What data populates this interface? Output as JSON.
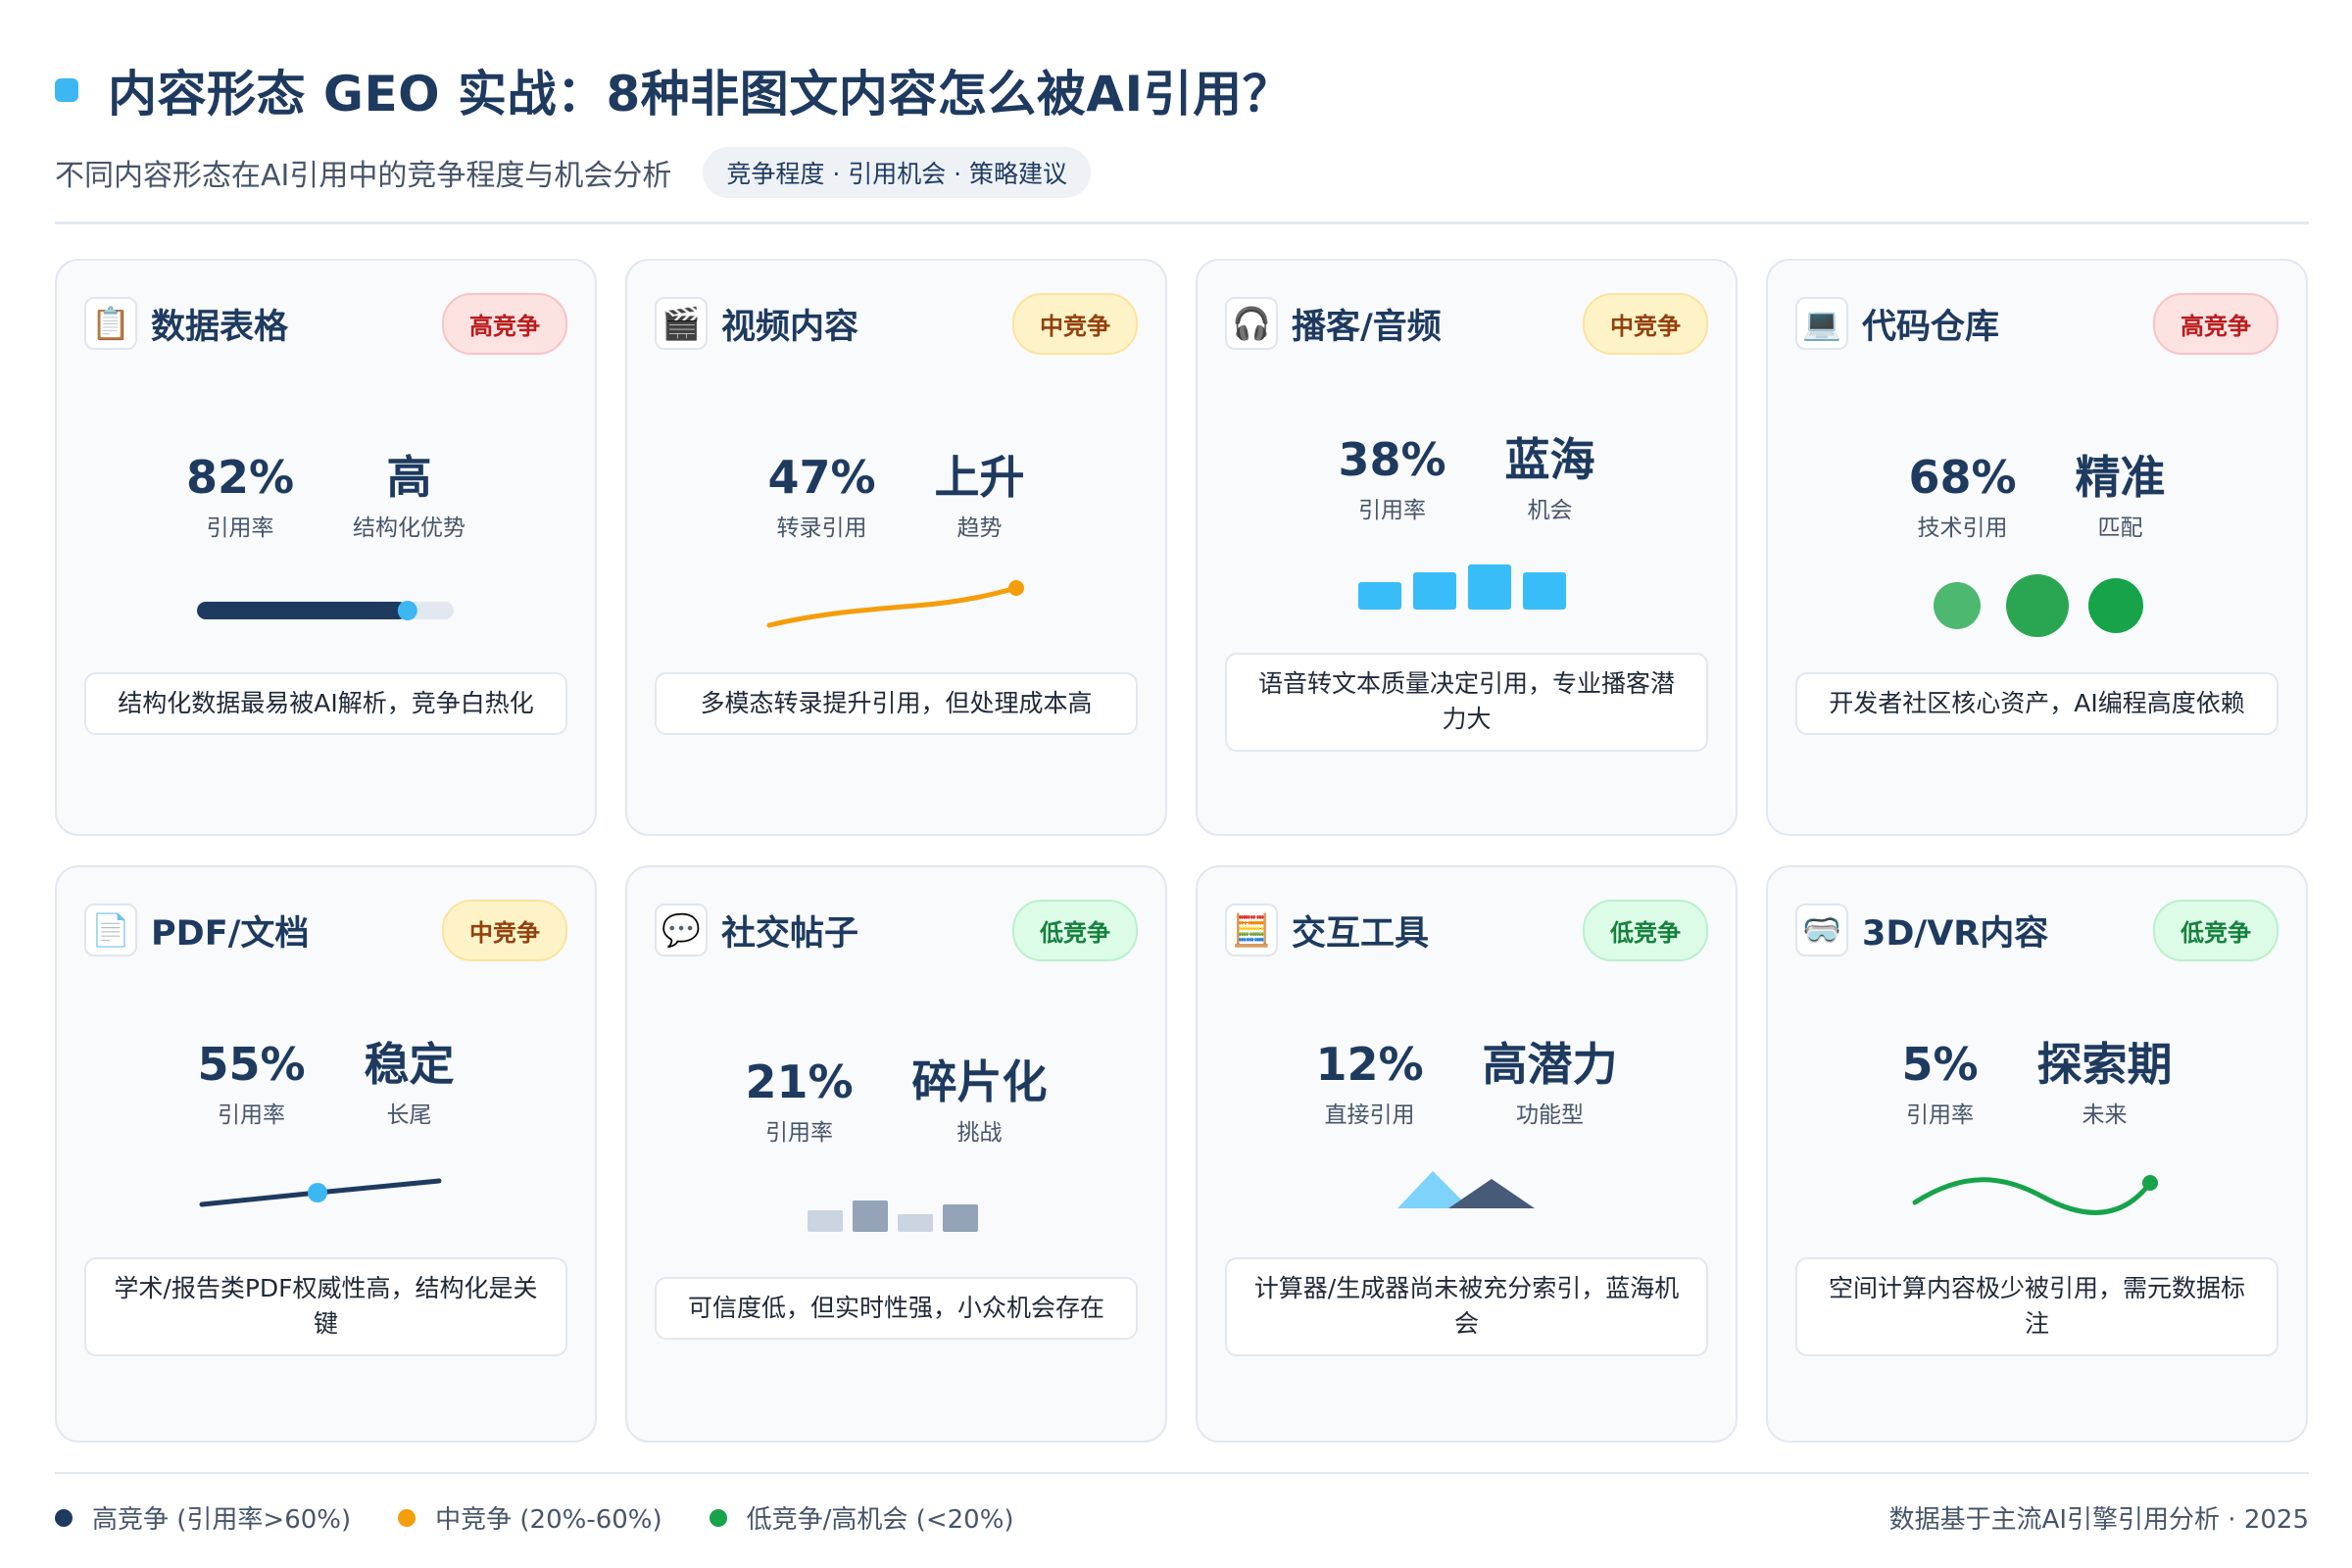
{
  "header": {
    "title": "内容形态 GEO 实战：8种非图文内容怎么被AI引用？",
    "subtitle": "不同内容形态在AI引用中的竞争程度与机会分析",
    "tags": "竞争程度 · 引用机会 · 策略建议"
  },
  "colors": {
    "accent": "#3cb7f2",
    "navy": "#1e3a5f",
    "orange": "#f59e0b",
    "green": "#16a34a",
    "red": "#b91c1c"
  },
  "cards": [
    {
      "icon": "clipboard-icon",
      "glyph": "📋",
      "title": "数据表格",
      "badge": "高竞争",
      "stat1": {
        "value": "82%",
        "label": "引用率"
      },
      "stat2": {
        "value": "高",
        "label": "结构化优势"
      },
      "visual": "progress-bar",
      "progress": 0.82,
      "desc": "结构化数据最易被AI解析，竞争白热化"
    },
    {
      "icon": "clapper-icon",
      "glyph": "🎬",
      "title": "视频内容",
      "badge": "中竞争",
      "stat1": {
        "value": "47%",
        "label": "转录引用"
      },
      "stat2": {
        "value": "上升",
        "label": "趋势"
      },
      "visual": "rising-line",
      "desc": "多模态转录提升引用，但处理成本高"
    },
    {
      "icon": "headphones-icon",
      "glyph": "🎧",
      "title": "播客/音频",
      "badge": "中竞争",
      "stat1": {
        "value": "38%",
        "label": "引用率"
      },
      "stat2": {
        "value": "蓝海",
        "label": "机会"
      },
      "visual": "blue-bars",
      "desc": "语音转文本质量决定引用，专业播客潜力大"
    },
    {
      "icon": "laptop-icon",
      "glyph": "💻",
      "title": "代码仓库",
      "badge": "高竞争",
      "stat1": {
        "value": "68%",
        "label": "技术引用"
      },
      "stat2": {
        "value": "精准",
        "label": "匹配"
      },
      "visual": "green-circles",
      "desc": "开发者社区核心资产，AI编程高度依赖"
    },
    {
      "icon": "document-icon",
      "glyph": "📄",
      "title": "PDF/文档",
      "badge": "中竞争",
      "stat1": {
        "value": "55%",
        "label": "引用率"
      },
      "stat2": {
        "value": "稳定",
        "label": "长尾"
      },
      "visual": "flat-line",
      "desc": "学术/报告类PDF权威性高，结构化是关键"
    },
    {
      "icon": "speech-bubble-icon",
      "glyph": "💬",
      "title": "社交帖子",
      "badge": "低竞争",
      "stat1": {
        "value": "21%",
        "label": "引用率"
      },
      "stat2": {
        "value": "碎片化",
        "label": "挑战"
      },
      "visual": "gray-bars",
      "desc": "可信度低，但实时性强，小众机会存在"
    },
    {
      "icon": "abacus-icon",
      "glyph": "🧮",
      "title": "交互工具",
      "badge": "低竞争",
      "stat1": {
        "value": "12%",
        "label": "直接引用"
      },
      "stat2": {
        "value": "高潜力",
        "label": "功能型"
      },
      "visual": "mountains",
      "desc": "计算器/生成器尚未被充分索引，蓝海机会"
    },
    {
      "icon": "vr-goggles-icon",
      "glyph": "🥽",
      "title": "3D/VR内容",
      "badge": "低竞争",
      "stat1": {
        "value": "5%",
        "label": "引用率"
      },
      "stat2": {
        "value": "探索期",
        "label": "未来"
      },
      "visual": "wave",
      "desc": "空间计算内容极少被引用，需元数据标注"
    }
  ],
  "legend": [
    {
      "label": "高竞争 (引用率>60%)",
      "color": "#1e3a5f"
    },
    {
      "label": "中竞争 (20%-60%)",
      "color": "#f59e0b"
    },
    {
      "label": "低竞争/高机会 (<20%)",
      "color": "#16a34a"
    }
  ],
  "footer": {
    "source": "数据基于主流AI引擎引用分析 · 2025"
  }
}
